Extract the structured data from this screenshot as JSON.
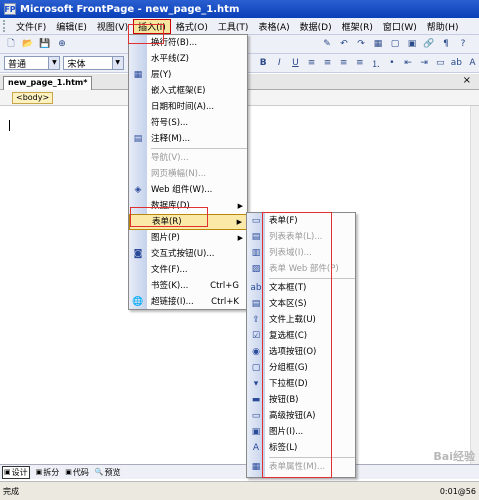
{
  "window": {
    "title": "Microsoft FrontPage - new_page_1.htm",
    "app_icon": "FP"
  },
  "menubar": [
    "文件(F)",
    "编辑(E)",
    "视图(V)",
    "插入(I)",
    "格式(O)",
    "工具(T)",
    "表格(A)",
    "数据(D)",
    "框架(R)",
    "窗口(W)",
    "帮助(H)"
  ],
  "toolbar2": {
    "style_value": "普通",
    "font_value": "宋体",
    "bold": "B",
    "italic": "I",
    "underline": "U"
  },
  "document": {
    "tab_label": "new_page_1.htm*",
    "tag": "<body>",
    "close": "×"
  },
  "insert_menu": [
    {
      "label": "换行符(B)...",
      "icon": "",
      "disabled": false
    },
    {
      "label": "水平线(Z)",
      "icon": "",
      "disabled": false
    },
    {
      "label": "层(Y)",
      "icon": "layer-icon",
      "disabled": false
    },
    {
      "label": "嵌入式框架(E)",
      "icon": "",
      "disabled": false
    },
    {
      "label": "日期和时间(A)...",
      "icon": "",
      "disabled": false
    },
    {
      "label": "符号(S)...",
      "icon": "",
      "disabled": false
    },
    {
      "label": "注释(M)...",
      "icon": "comment-icon",
      "disabled": false
    },
    {
      "sep": true
    },
    {
      "label": "导航(V)...",
      "icon": "",
      "disabled": true
    },
    {
      "label": "网页横幅(N)...",
      "icon": "",
      "disabled": true
    },
    {
      "label": "Web 组件(W)...",
      "icon": "web-component-icon",
      "disabled": false
    },
    {
      "label": "数据库(D)",
      "icon": "",
      "disabled": false,
      "sub": true
    },
    {
      "label": "表单(R)",
      "icon": "",
      "disabled": false,
      "sub": true,
      "highlight": true
    },
    {
      "label": "图片(P)",
      "icon": "",
      "disabled": false,
      "sub": true
    },
    {
      "label": "交互式按钮(U)...",
      "icon": "interactive-button-icon",
      "disabled": false
    },
    {
      "label": "文件(F)...",
      "icon": "",
      "disabled": false
    },
    {
      "label": "书签(K)...",
      "shortcut": "Ctrl+G",
      "icon": "",
      "disabled": false
    },
    {
      "label": "超链接(I)...",
      "shortcut": "Ctrl+K",
      "icon": "hyperlink-icon",
      "disabled": false
    }
  ],
  "form_menu": [
    {
      "label": "表单(F)",
      "icon": "form-icon",
      "disabled": false
    },
    {
      "label": "列表表单(L)...",
      "icon": "list-form-icon",
      "disabled": true
    },
    {
      "label": "列表域(I)...",
      "icon": "list-field-icon",
      "disabled": true
    },
    {
      "label": "表单 Web 部件(P)",
      "icon": "form-web-part-icon",
      "disabled": true
    },
    {
      "sep": true
    },
    {
      "label": "文本框(T)",
      "icon": "textbox-icon",
      "disabled": false
    },
    {
      "label": "文本区(S)",
      "icon": "textarea-icon",
      "disabled": false
    },
    {
      "label": "文件上载(U)",
      "icon": "file-upload-icon",
      "disabled": false
    },
    {
      "label": "复选框(C)",
      "icon": "checkbox-icon",
      "disabled": false
    },
    {
      "label": "选项按钮(O)",
      "icon": "radio-button-icon",
      "disabled": false
    },
    {
      "label": "分组框(G)",
      "icon": "group-box-icon",
      "disabled": false
    },
    {
      "label": "下拉框(D)",
      "icon": "dropdown-icon",
      "disabled": false
    },
    {
      "label": "按钮(B)",
      "icon": "button-icon",
      "disabled": false
    },
    {
      "label": "高级按钮(A)",
      "icon": "advanced-button-icon",
      "disabled": false
    },
    {
      "label": "图片(I)...",
      "icon": "picture-icon",
      "disabled": false
    },
    {
      "label": "标签(L)",
      "icon": "label-icon",
      "disabled": false
    },
    {
      "sep": true
    },
    {
      "label": "表单属性(M)...",
      "icon": "form-properties-icon",
      "disabled": true
    }
  ],
  "view_tabs": [
    "设计",
    "拆分",
    "代码",
    "预览"
  ],
  "status": {
    "left": "完成",
    "right": "0:01@56"
  },
  "watermark": "Bai经验"
}
